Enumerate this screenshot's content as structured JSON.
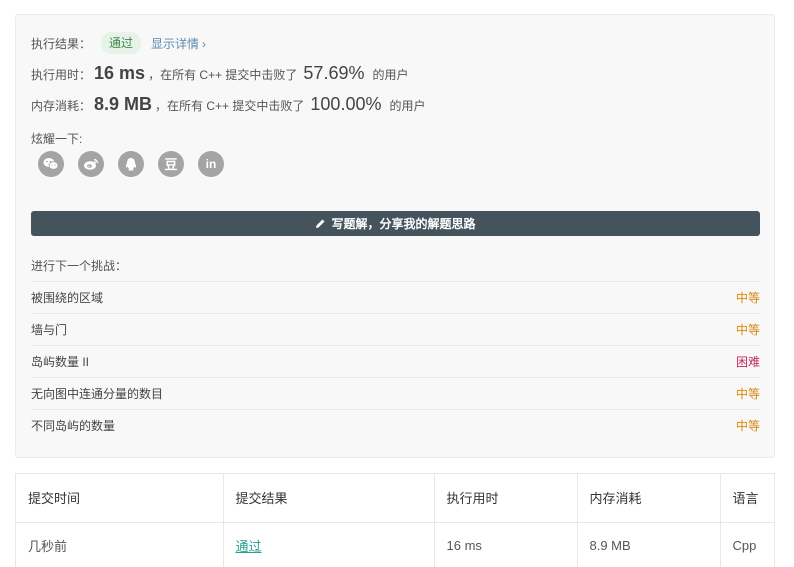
{
  "result": {
    "label": "执行结果：",
    "status": "通过",
    "detail_link": "显示详情",
    "detail_chevron": "›"
  },
  "runtime": {
    "label": "执行用时：",
    "value": "16 ms",
    "text_before": "，在所有 C++ 提交中击败了",
    "percent": "57.69%",
    "text_after": "的用户"
  },
  "memory": {
    "label": "内存消耗：",
    "value": "8.9 MB",
    "text_before": "，在所有 C++ 提交中击败了",
    "percent": "100.00%",
    "text_after": "的用户"
  },
  "share": {
    "label": "炫耀一下:",
    "icons": [
      "wechat-icon",
      "weibo-icon",
      "qq-icon",
      "douban-icon",
      "linkedin-icon"
    ],
    "douban_text": "豆",
    "linkedin_text": "in"
  },
  "write_solution": {
    "icon": "pencil-icon",
    "label": "写题解，分享我的解题思路"
  },
  "next_challenge": {
    "label": "进行下一个挑战：",
    "items": [
      {
        "title": "被围绕的区域",
        "difficulty": "中等"
      },
      {
        "title": "墙与门",
        "difficulty": "中等"
      },
      {
        "title": "岛屿数量 II",
        "difficulty": "困难"
      },
      {
        "title": "无向图中连通分量的数目",
        "difficulty": "中等"
      },
      {
        "title": "不同岛屿的数量",
        "difficulty": "中等"
      }
    ]
  },
  "colors": {
    "medium": "#d48806",
    "hard": "#c52a60",
    "button": "#44535c",
    "pass_link": "#27a193"
  },
  "submissions": {
    "headers": [
      "提交时间",
      "提交结果",
      "执行用时",
      "内存消耗",
      "语言"
    ],
    "rows": [
      {
        "time": "几秒前",
        "result": "通过",
        "runtime": "16 ms",
        "memory": "8.9 MB",
        "language": "Cpp"
      }
    ]
  }
}
